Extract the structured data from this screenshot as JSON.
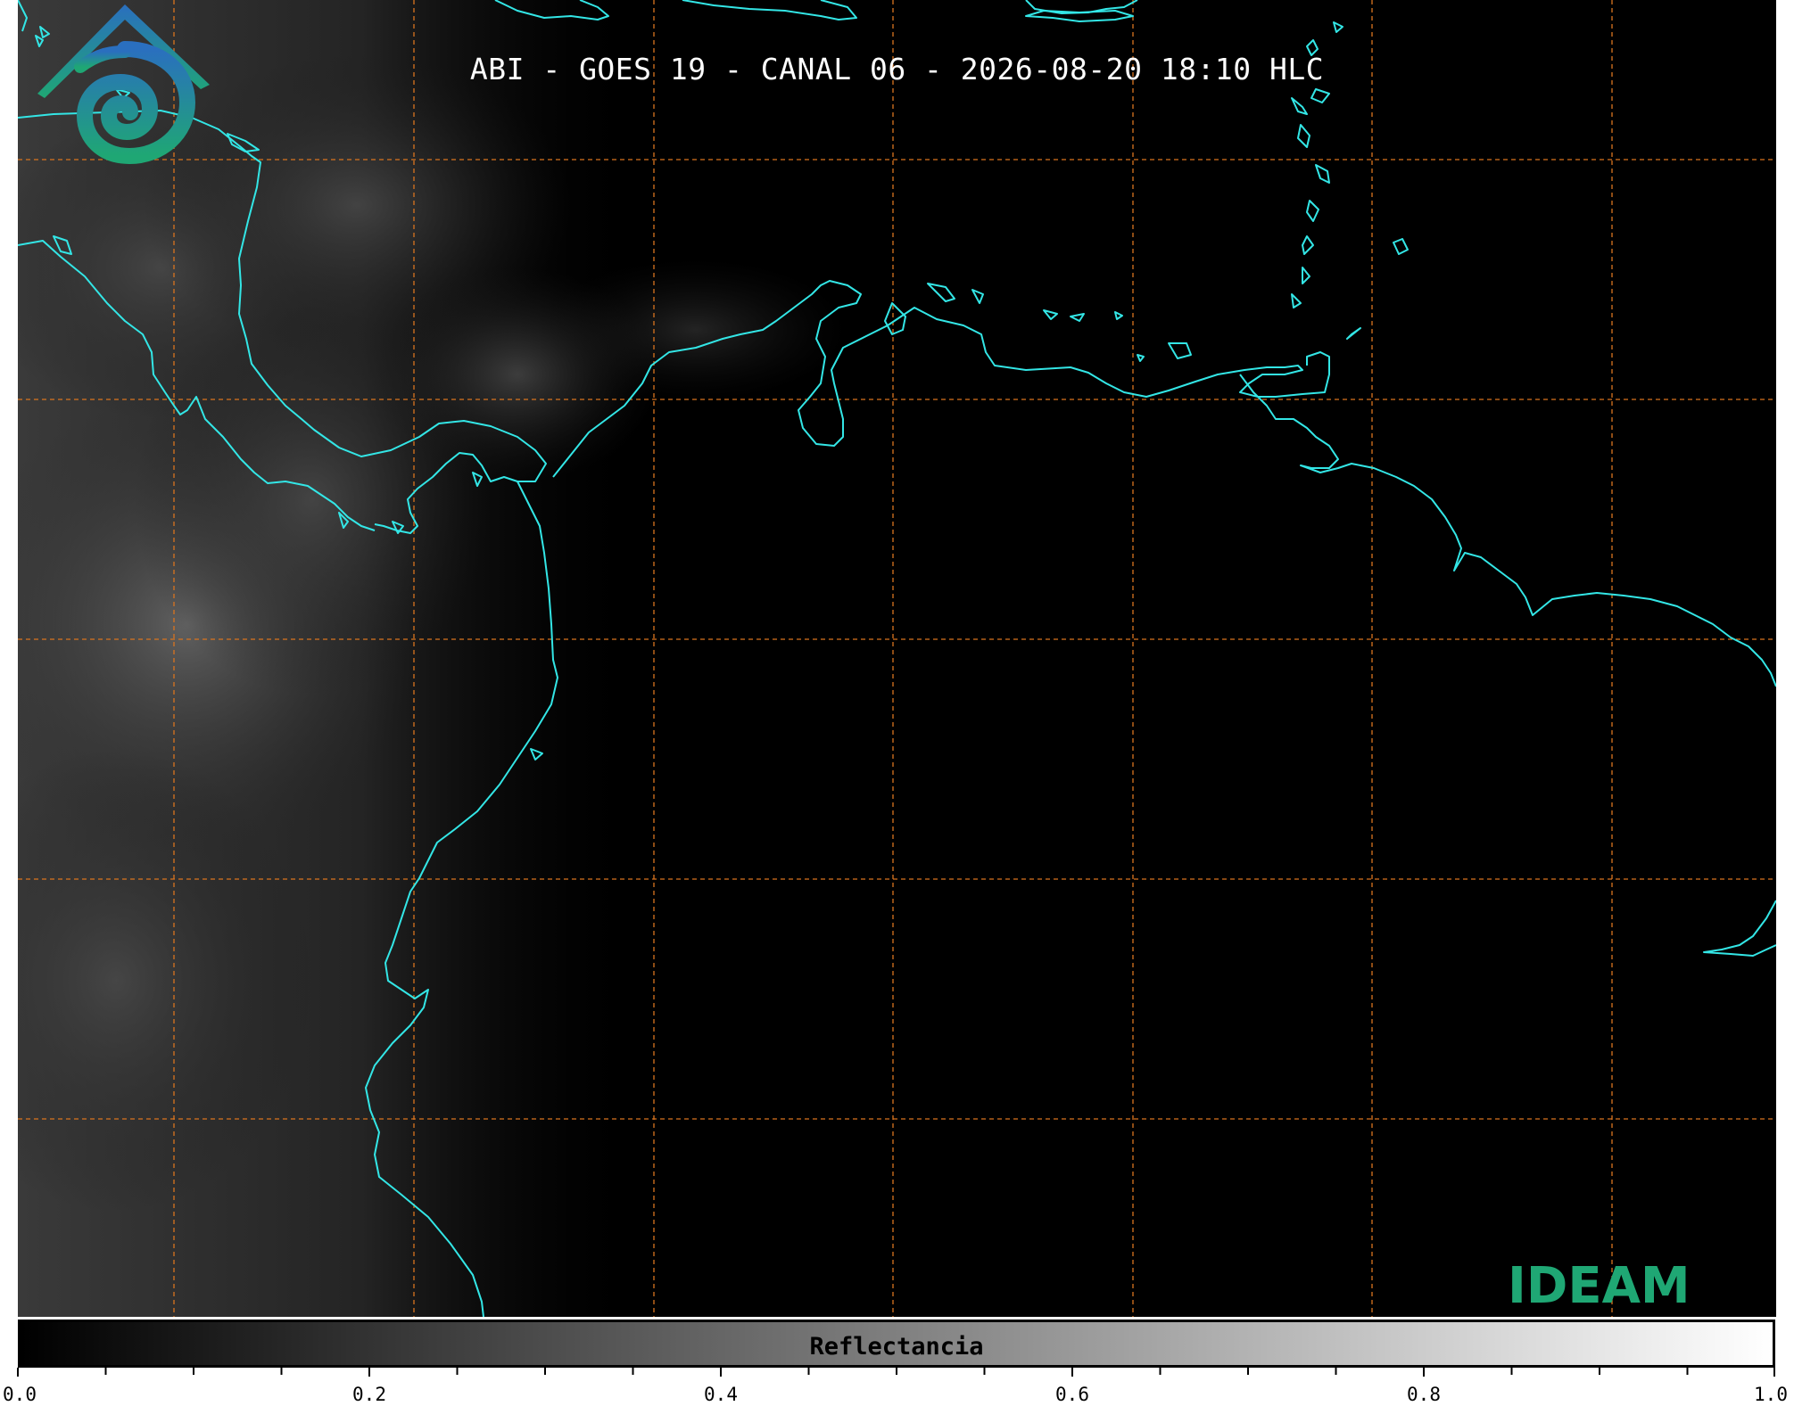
{
  "title": "ABI - GOES 19 - CANAL 06 - 2026-08-20 18:10 HLC",
  "colorbar": {
    "label": "Reflectancia",
    "range": [
      0.0,
      1.0
    ],
    "tick_labels": [
      "0.0",
      "0.2",
      "0.4",
      "0.6",
      "0.8",
      "1.0"
    ],
    "colors": [
      "#000000",
      "#ffffff"
    ]
  },
  "logo": {
    "text": "IDEAM",
    "icon": "ideam-mountain-swirl-icon"
  },
  "map": {
    "background": "#000000",
    "coastline_color": "#33e6e6",
    "grid_color": "#d9741f"
  }
}
